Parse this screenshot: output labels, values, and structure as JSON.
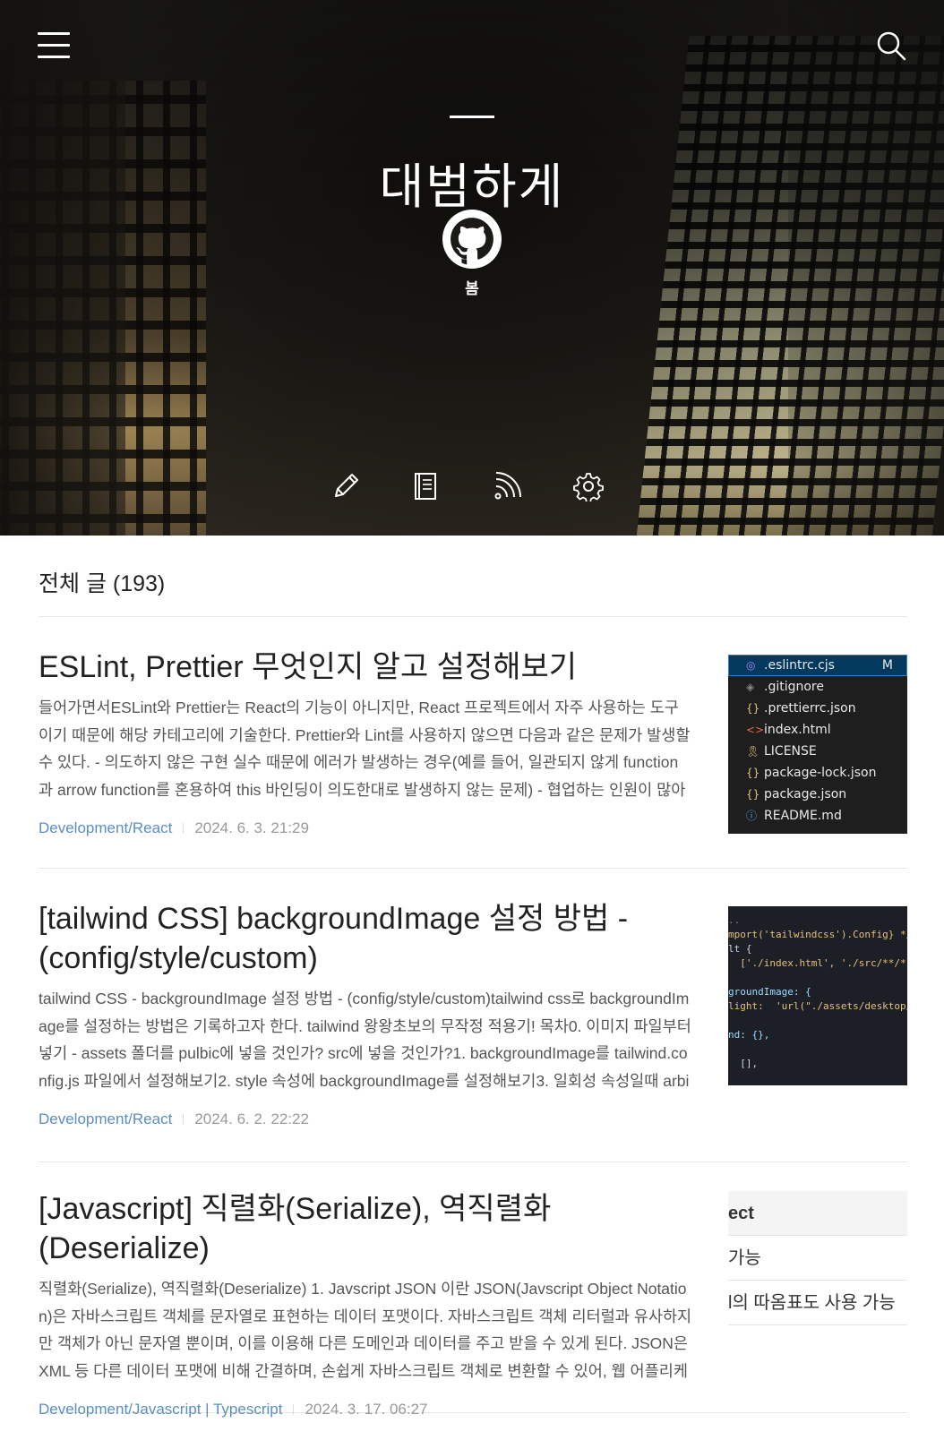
{
  "blog": {
    "title": "대범하게",
    "owner": "봄"
  },
  "icons": {
    "menu": "hamburger-menu-icon",
    "search": "search-icon",
    "avatar": "github-icon",
    "tools": [
      "pencil-icon",
      "book-icon",
      "rss-icon",
      "gear-icon"
    ]
  },
  "list": {
    "heading": "전체 글 (193)"
  },
  "posts": [
    {
      "title": "ESLint, Prettier 무엇인지 알고 설정해보기",
      "excerpt": "들어가면서ESLint와 Prettier는 React의 기능이 아니지만, React 프로젝트에서 자주 사용하는 도구이기 때문에 해당 카테고리에 기술한다.  Prettier와 Lint를 사용하지 않으면 다음과 같은 문제가 발생할 수 있다.  - 의도하지 않은 구현 실수 때문에 에러가 발생하는 경우(예를 들어, 일관되지 않게 function과 arrow function를 혼용하여 this 바인딩이 의도한대로 발생하지 않는 문제) - 협업하는 인원이 많아질수록 코드 스타일이 달라지는 문제",
      "category": "Development/React",
      "date": "2024. 6. 3. 21:29",
      "thumbnail": {
        "files": [
          {
            "icon": "◎",
            "name": ".eslintrc.cjs",
            "badge": "M"
          },
          {
            "icon": "◈",
            "name": ".gitignore",
            "badge": ""
          },
          {
            "icon": "{}",
            "name": ".prettierrc.json",
            "badge": ""
          },
          {
            "icon": "<>",
            "name": "index.html",
            "badge": ""
          },
          {
            "icon": "🎗",
            "name": "LICENSE",
            "badge": ""
          },
          {
            "icon": "{}",
            "name": "package-lock.json",
            "badge": ""
          },
          {
            "icon": "{}",
            "name": "package.json",
            "badge": ""
          },
          {
            "icon": "ⓘ",
            "name": "README.md",
            "badge": ""
          }
        ]
      }
    },
    {
      "title": "[tailwind CSS] backgroundImage 설정 방법 - (config/style/custom)",
      "excerpt": "tailwind CSS - backgroundImage 설정 방법 - (config/style/custom)tailwind css로 backgroundImage를 설정하는 방법은 기록하고자 한다. tailwind 왕왕초보의 무작정 적용기! 목차0. 이미지 파일부터 넣기 - assets 폴더를 pulbic에 넣을 것인가? src에 넣을 것인가?1. backgroundImage를 tailwind.config.js 파일에서 설정해보기2. style 속성에 backgroundImage를 설정해보기3. 일회성 속성일때 arbitrary value 사용하기",
      "category": "Development/React",
      "date": "2024. 6. 2. 22:22",
      "thumbnail": {
        "code": [
          "..",
          "mport('tailwindcss').Config} */",
          "lt {",
          "  ['./index.html', './src/**/*.{",
          "",
          "groundImage: {",
          "light:  'url(\"./assets/desktop/c",
          "",
          "nd: {},",
          "",
          "  [],"
        ]
      }
    },
    {
      "title": "[Javascript] 직렬화(Serialize), 역직렬화(Deserialize)",
      "excerpt": "직렬화(Serialize), 역직렬화(Deserialize) 1. Javscript JSON 이란 JSON(Javscript Object Notation)은 자바스크립트 객체를 문자열로 표현하는 데이터 포맷이다. 자바스크립트 객체 리터럴과 유사하지만 객체가 아닌 문자열 뿐이며, 이를 이용해 다른 도메인과 데이터를 주고 받을 수 있게 된다. JSON은 XML 등 다른 데이터 포맷에 비해 간결하며, 손쉽게 자바스크립트 객체로 변환할 수 있어, 웹 어플리케이션에서 데이터를 전송할 때 많이 쓰인다.",
      "category": "Development/Javascript | Typescript",
      "date": "2024. 3. 17. 06:27",
      "thumbnail": {
        "rows": [
          "ect",
          "가능",
          "l의 따옴표도 사용 가능"
        ]
      }
    }
  ]
}
